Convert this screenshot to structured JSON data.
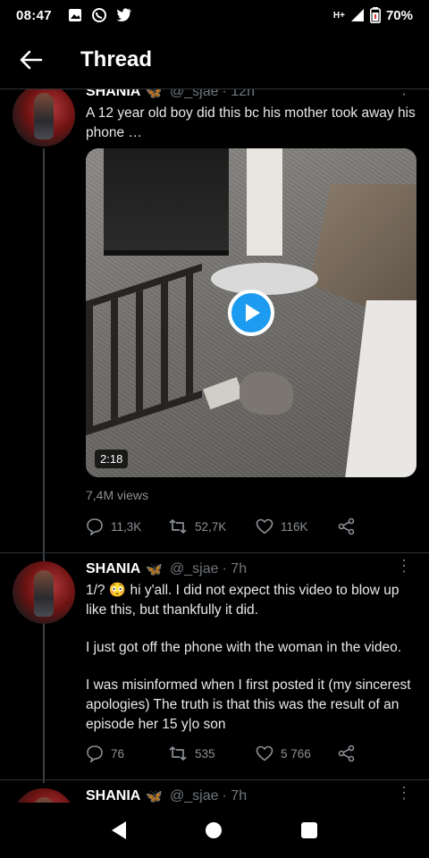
{
  "status_bar": {
    "time": "08:47",
    "network": "H+",
    "battery": "70%",
    "icons": [
      "gallery-icon",
      "whatsapp-icon",
      "twitter-icon"
    ]
  },
  "header": {
    "title": "Thread",
    "back_icon": "arrow-left-icon"
  },
  "tweets": [
    {
      "name": "SHANIA",
      "handle": "@_sjae",
      "time": "· 12h",
      "text": "A 12 year old boy did this bc his mother took away his phone …",
      "video_duration": "2:18",
      "views": "7,4M views",
      "replies": "11,3K",
      "retweets": "52,7K",
      "likes": "116K"
    },
    {
      "name": "SHANIA",
      "handle": "@_sjae",
      "time": "· 7h",
      "paragraphs": [
        "1/? 😳 hi y'all. I did not expect this video to blow up like this, but thankfully it did.",
        "I just got off the phone with the woman in the video.",
        "I was misinformed when I first posted it (my sincerest apologies) The truth is that this was the result of an episode her 15 y|o son"
      ],
      "replies": "76",
      "retweets": "535",
      "likes": "5 766"
    },
    {
      "name": "SHANIA",
      "handle": "@_sjae",
      "time": "· 7h"
    }
  ],
  "colors": {
    "background": "#000000",
    "accent": "#1d9bf0",
    "muted": "#71767b"
  }
}
